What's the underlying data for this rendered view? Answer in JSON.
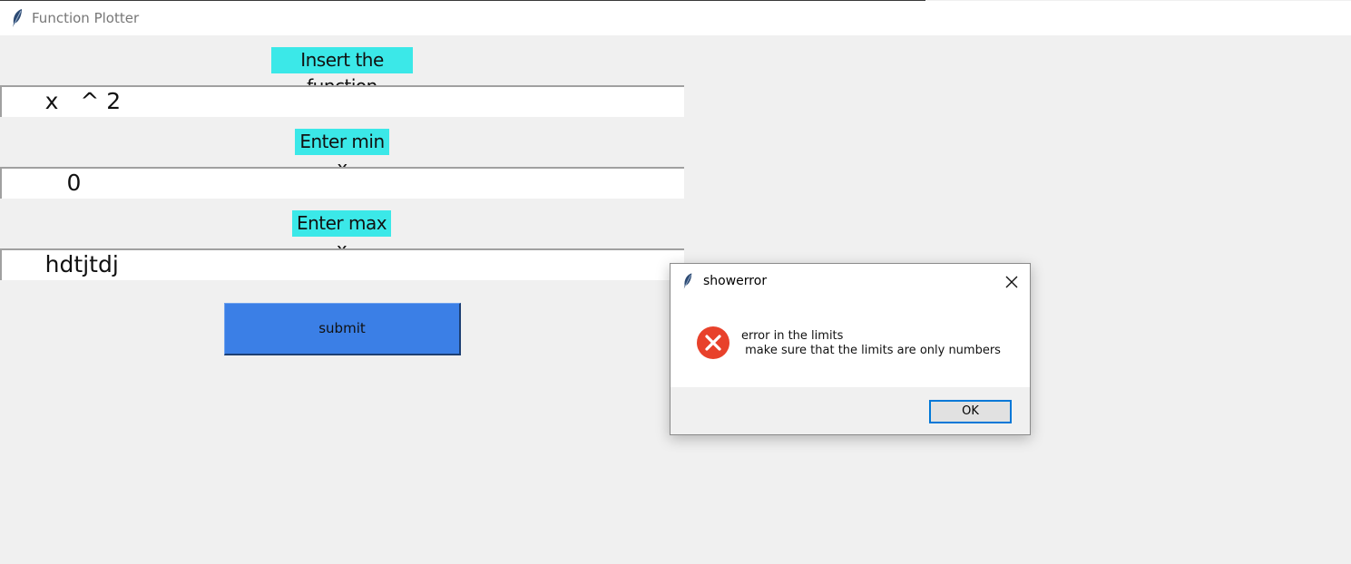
{
  "window": {
    "title": "Function Plotter",
    "icon": "feather-icon"
  },
  "form": {
    "function_label": "Insert the function",
    "function_value": "      x   ^ 2",
    "min_label": "Enter min x",
    "min_value": "         0",
    "max_label": "Enter max x",
    "max_value": "      hdtjtdj",
    "submit_label": "submit"
  },
  "dialog": {
    "title": "showerror",
    "icon": "feather-icon",
    "error_icon": "error-x-icon",
    "close_icon": "close-icon",
    "message_line1": "error in the limits",
    "message_line2": " make sure that the limits are only numbers",
    "ok_label": "OK"
  },
  "colors": {
    "label_bg": "#3be8e8",
    "submit_bg": "#3b7fe6",
    "error_red": "#e8412b",
    "focus_blue": "#0078d7"
  }
}
